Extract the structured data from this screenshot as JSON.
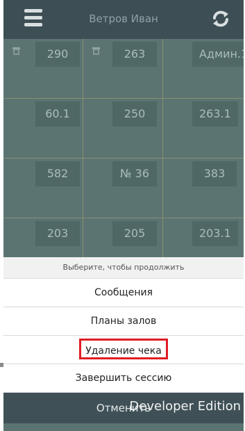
{
  "header": {
    "title": "Ветров Иван",
    "menu_icon": "hamburger-menu-icon",
    "refresh_icon": "refresh-icon"
  },
  "tables": [
    [
      "290",
      "263",
      "Админ.1"
    ],
    [
      "60.1",
      "250",
      "263.1"
    ],
    [
      "582",
      "№ 36",
      "383"
    ],
    [
      "203",
      "205",
      "203.1"
    ]
  ],
  "sheet": {
    "prompt": "Выберите, чтобы продолжить",
    "items": [
      "Сообщения",
      "Планы залов",
      "Удаление чека",
      "Завершить сессию"
    ],
    "cancel": "Отменить",
    "highlighted_item": "Удаление чека"
  },
  "watermark": "Developer Edition",
  "colors": {
    "topbar": "#3d4f55",
    "grid": "#5b7472",
    "highlight": "#e01b24"
  }
}
